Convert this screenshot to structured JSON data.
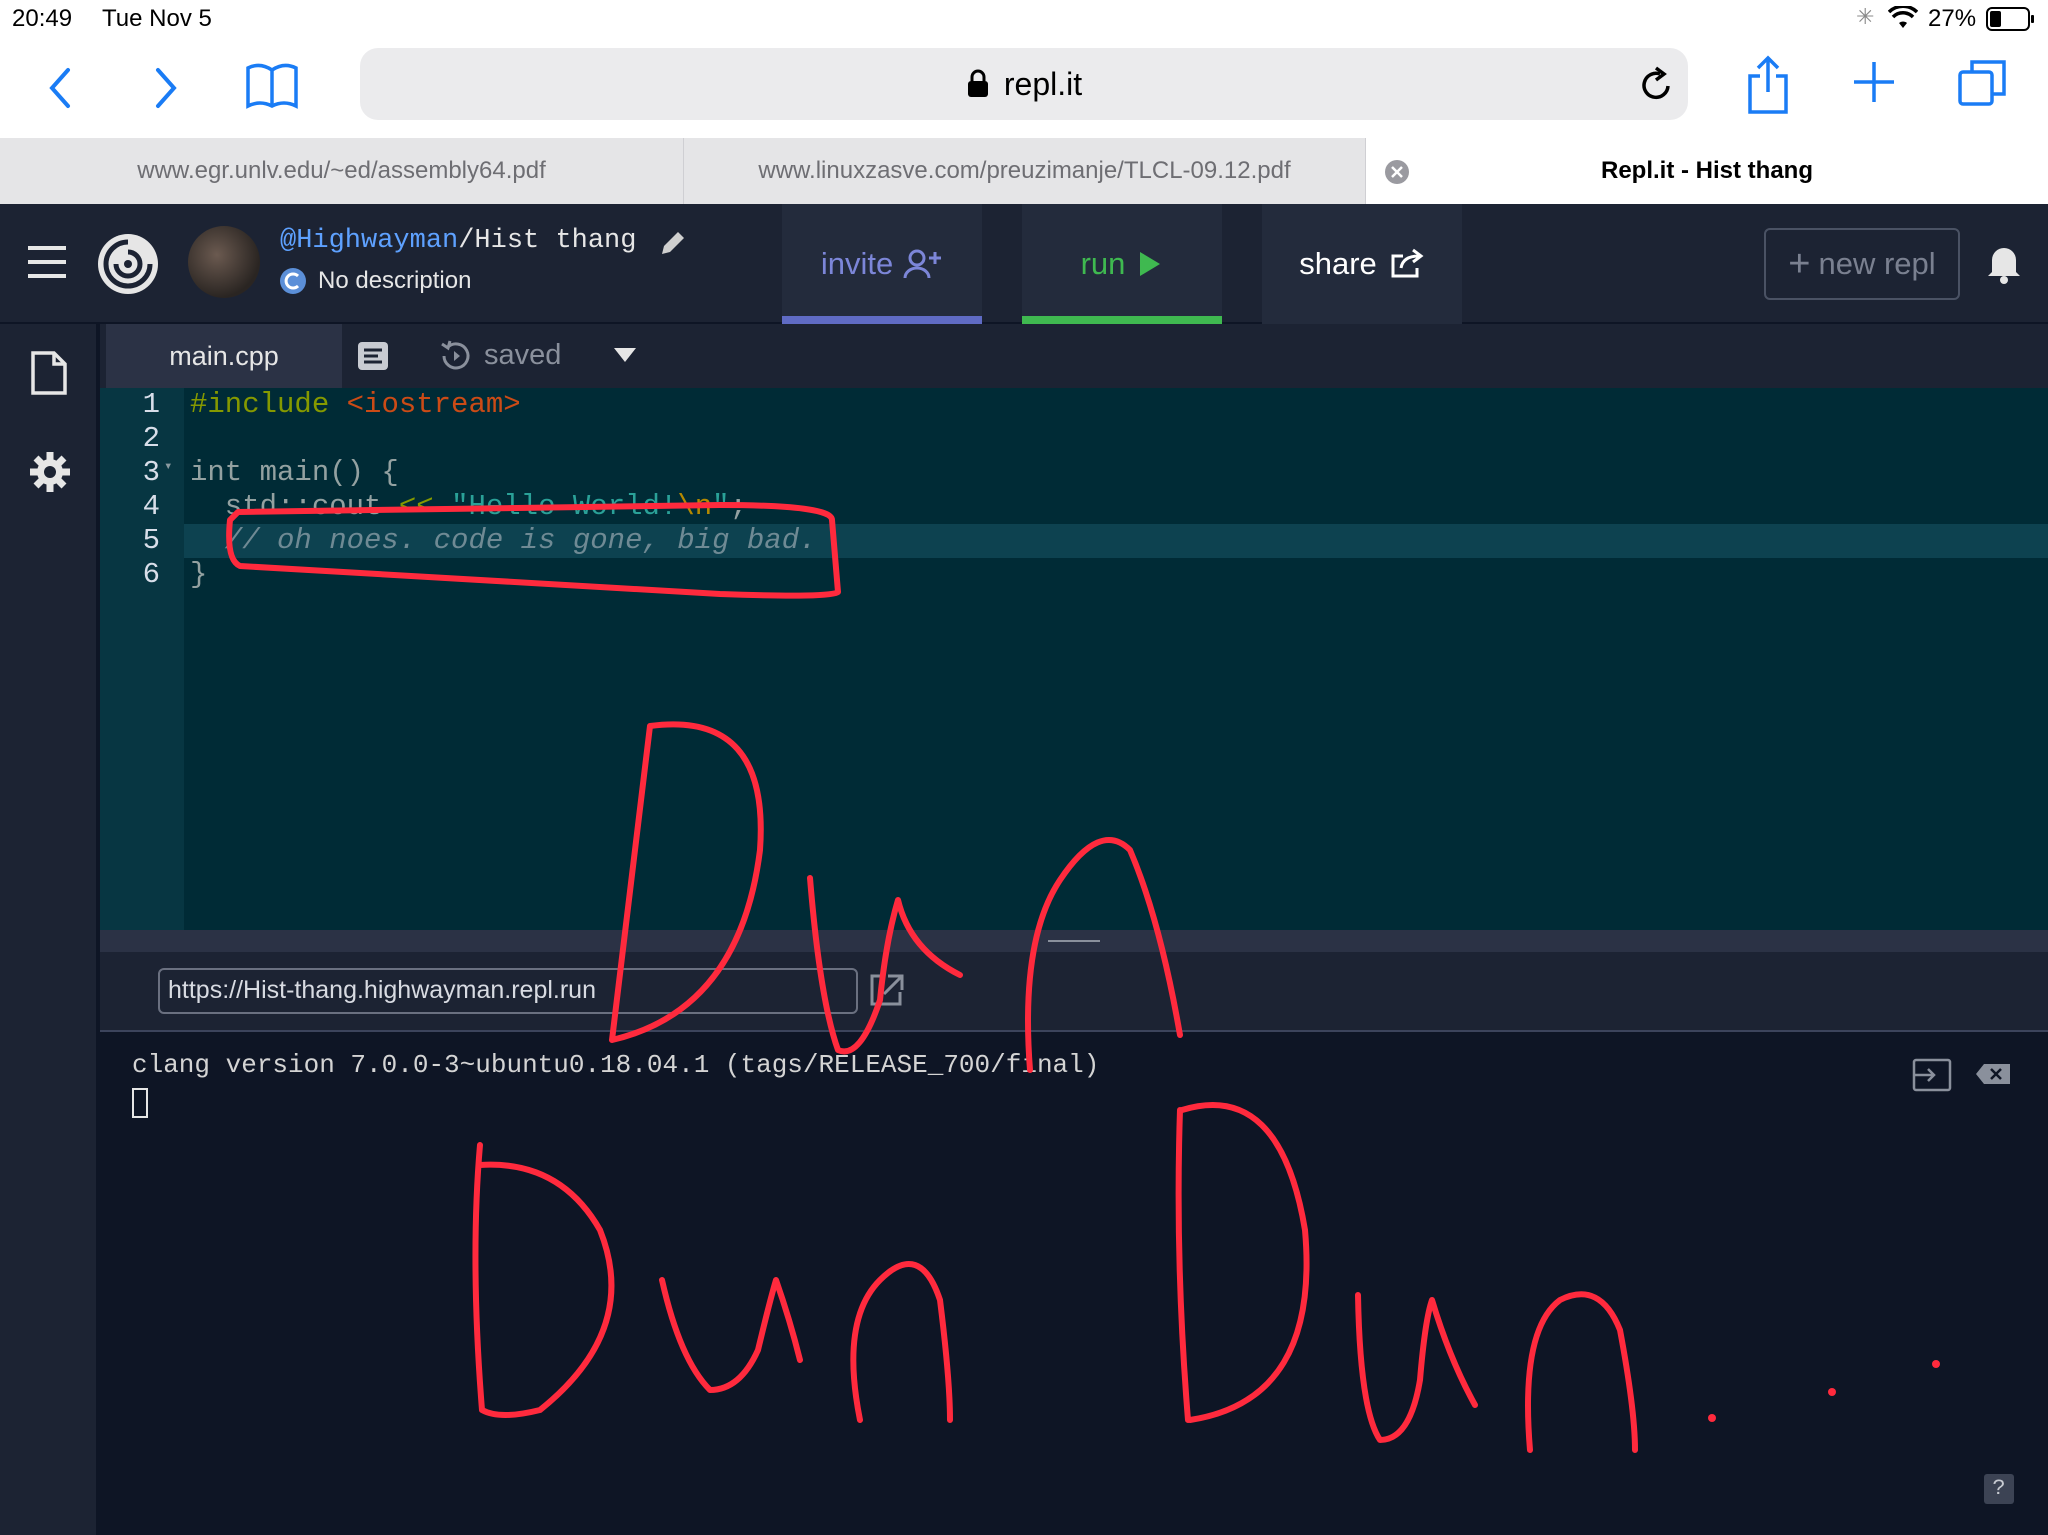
{
  "status_bar": {
    "time": "20:49",
    "date": "Tue Nov 5",
    "battery": "27%"
  },
  "safari": {
    "url": "repl.it",
    "tabs": [
      {
        "title": "www.egr.unlv.edu/~ed/assembly64.pdf",
        "active": false
      },
      {
        "title": "www.linuxzasve.com/preuzimanje/TLCL-09.12.pdf",
        "active": false
      },
      {
        "title": "Repl.it - Hist thang",
        "active": true
      }
    ]
  },
  "repl_header": {
    "username": "@Highwayman",
    "repl_name": "/Hist thang",
    "description": "No description",
    "invite_label": "invite",
    "run_label": "run",
    "share_label": "share",
    "new_repl_label": "new repl",
    "colors": {
      "invite": "#7c86d8",
      "run": "#3fb950",
      "share": "#ffffff"
    }
  },
  "editor": {
    "filename": "main.cpp",
    "save_status": "saved",
    "lines": [
      {
        "num": "1",
        "text": "#include <iostream>"
      },
      {
        "num": "2",
        "text": ""
      },
      {
        "num": "3",
        "text": "int main() {"
      },
      {
        "num": "4",
        "text": "  std::cout << \"Hello World!\\n\";"
      },
      {
        "num": "5",
        "text": "  // oh noes. code is gone, big bad."
      },
      {
        "num": "6",
        "text": "}"
      }
    ]
  },
  "webview": {
    "url": "https://Hist-thang.highwayman.repl.run"
  },
  "console": {
    "output_line": "clang version 7.0.0-3~ubuntu0.18.04.1 (tags/RELEASE_700/final)"
  },
  "annotation": {
    "text": "Dun Dun Dun...",
    "color": "#ff2a3d"
  }
}
